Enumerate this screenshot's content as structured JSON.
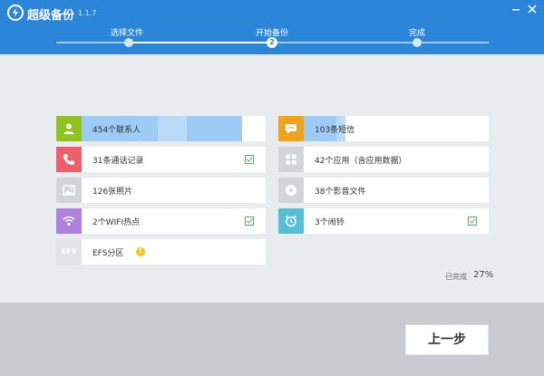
{
  "app": {
    "title": "超级备份",
    "version": "1.1.7"
  },
  "steps": [
    {
      "label": "选择文件",
      "state": "done"
    },
    {
      "label": "开始备份",
      "state": "active",
      "number": "2"
    },
    {
      "label": "完成",
      "state": "pending"
    }
  ],
  "items_left": [
    {
      "label": "454个联系人",
      "icon": "contact-icon",
      "color": "#8fc320",
      "progress": 0.86,
      "checked": false
    },
    {
      "label": "31条通话记录",
      "icon": "phone-icon",
      "color": "#ee5f6a",
      "checked": true
    },
    {
      "label": "126张照片",
      "icon": "photo-icon",
      "color": "#d1d5d9",
      "checked": false
    },
    {
      "label": "2个WIFI热点",
      "icon": "wifi-icon",
      "color": "#b07fe0",
      "checked": true
    },
    {
      "label": "EFS分区",
      "icon": "efs-icon",
      "icon_text": "EFS",
      "color": "#e1e4e7",
      "warning": "!"
    }
  ],
  "items_right": [
    {
      "label": "103条短信",
      "icon": "message-icon",
      "color": "#f1a11a",
      "progress": 0.18,
      "checked": false
    },
    {
      "label": "42个应用（含应用数据）",
      "icon": "apps-icon",
      "color": "#d1d5d9",
      "checked": false
    },
    {
      "label": "38个影音文件",
      "icon": "media-icon",
      "color": "#d1d5d9",
      "checked": false
    },
    {
      "label": "3个闹铃",
      "icon": "alarm-icon",
      "color": "#56bfd6",
      "checked": true
    }
  ],
  "status": {
    "done_label": "已完成",
    "percent": "27%"
  },
  "buttons": {
    "prev": "上一步"
  }
}
